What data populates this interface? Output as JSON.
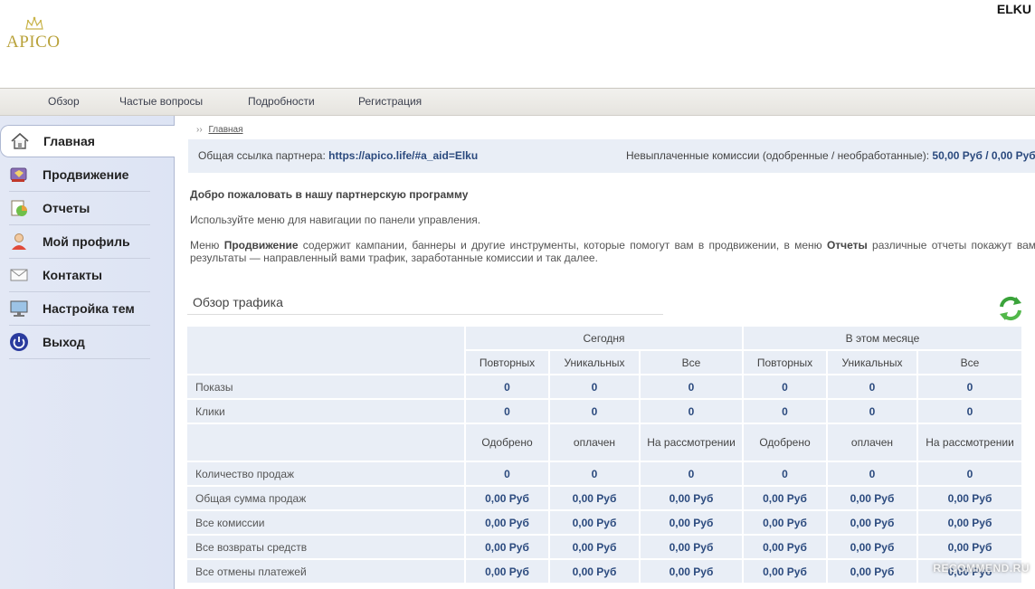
{
  "header": {
    "logo_text": "APICO",
    "username": "ELKU"
  },
  "topnav": {
    "items": [
      "Обзор",
      "Частые вопросы",
      "Подробности",
      "Регистрация"
    ]
  },
  "sidebar": {
    "items": [
      {
        "label": "Главная",
        "icon": "home-icon",
        "active": true
      },
      {
        "label": "Продвижение",
        "icon": "promo-icon"
      },
      {
        "label": "Отчеты",
        "icon": "reports-icon"
      },
      {
        "label": "Мой профиль",
        "icon": "profile-icon"
      },
      {
        "label": "Контакты",
        "icon": "envelope-icon"
      },
      {
        "label": "Настройка тем",
        "icon": "monitor-icon"
      },
      {
        "label": "Выход",
        "icon": "power-icon"
      }
    ]
  },
  "breadcrumb": {
    "sep": "››",
    "link": "Главная"
  },
  "refbar": {
    "link_label": "Общая ссылка партнера:",
    "link_value": "https://apico.life/#a_aid=Elku",
    "commission_label": "Невыплаченные комиссии (одобренные / необработанные):",
    "commission_value": "50,00 Руб / 0,00 Руб"
  },
  "welcome": {
    "title": "Добро пожаловать в нашу партнерскую программу",
    "nav_hint": "Используйте меню для навигации по панели управления.",
    "desc_1": "Меню ",
    "desc_b1": "Продвижение",
    "desc_2": " содержит кампании, баннеры и другие инструменты, которые помогут вам в продвижении, в меню ",
    "desc_b2": "Отчеты",
    "desc_3": " различные отчеты покажут вам результаты — направленный вами трафик, заработанные комиссии и так далее."
  },
  "traffic": {
    "title": "Обзор трафика",
    "groups": [
      "Сегодня",
      "В этом месяце"
    ],
    "col_headers": [
      "Повторных",
      "Уникальных",
      "Все",
      "Повторных",
      "Уникальных",
      "Все"
    ],
    "rows_top": [
      {
        "label": "Показы",
        "values": [
          "0",
          "0",
          "0",
          "0",
          "0",
          "0"
        ]
      },
      {
        "label": "Клики",
        "values": [
          "0",
          "0",
          "0",
          "0",
          "0",
          "0"
        ]
      }
    ],
    "status_headers": [
      "Одобрено",
      "оплачен",
      "На рассмотрении",
      "Одобрено",
      "оплачен",
      "На рассмотрении"
    ],
    "rows_bottom": [
      {
        "label": "Количество продаж",
        "values": [
          "0",
          "0",
          "0",
          "0",
          "0",
          "0"
        ]
      },
      {
        "label": "Общая сумма продаж",
        "values": [
          "0,00 Руб",
          "0,00 Руб",
          "0,00 Руб",
          "0,00 Руб",
          "0,00 Руб",
          "0,00 Руб"
        ]
      },
      {
        "label": "Все комиссии",
        "values": [
          "0,00 Руб",
          "0,00 Руб",
          "0,00 Руб",
          "0,00 Руб",
          "0,00 Руб",
          "0,00 Руб"
        ]
      },
      {
        "label": "Все возвраты средств",
        "values": [
          "0,00 Руб",
          "0,00 Руб",
          "0,00 Руб",
          "0,00 Руб",
          "0,00 Руб",
          "0,00 Руб"
        ]
      },
      {
        "label": "Все отмены платежей",
        "values": [
          "0,00 Руб",
          "0,00 Руб",
          "0,00 Руб",
          "0,00 Руб",
          "0,00 Руб",
          "0,00 Руб"
        ]
      }
    ]
  },
  "watermark": "RECOMMEND.RU"
}
